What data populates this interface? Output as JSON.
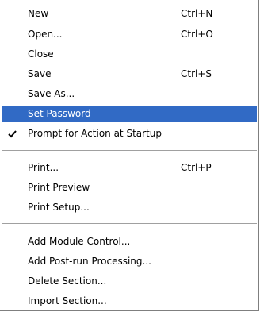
{
  "menu": {
    "items": [
      {
        "label": "New",
        "shortcut": "Ctrl+N"
      },
      {
        "label": "Open...",
        "shortcut": "Ctrl+O"
      },
      {
        "label": "Close",
        "shortcut": ""
      },
      {
        "label": "Save",
        "shortcut": "Ctrl+S"
      },
      {
        "label": "Save As...",
        "shortcut": ""
      },
      {
        "label": "Set Password",
        "shortcut": "",
        "highlighted": true
      },
      {
        "label": "Prompt for Action at Startup",
        "shortcut": "",
        "checked": true
      },
      {
        "label": "Print...",
        "shortcut": "Ctrl+P"
      },
      {
        "label": "Print Preview",
        "shortcut": ""
      },
      {
        "label": "Print Setup...",
        "shortcut": ""
      },
      {
        "label": "Add Module Control...",
        "shortcut": ""
      },
      {
        "label": "Add Post-run Processing...",
        "shortcut": ""
      },
      {
        "label": "Delete Section...",
        "shortcut": ""
      },
      {
        "label": "Import Section...",
        "shortcut": ""
      }
    ]
  },
  "colors": {
    "highlight": "#316ac5",
    "highlight_text": "#ffffff",
    "text": "#000000",
    "separator": "#a0a0a0"
  },
  "icons": {
    "check": "checkmark-icon"
  }
}
